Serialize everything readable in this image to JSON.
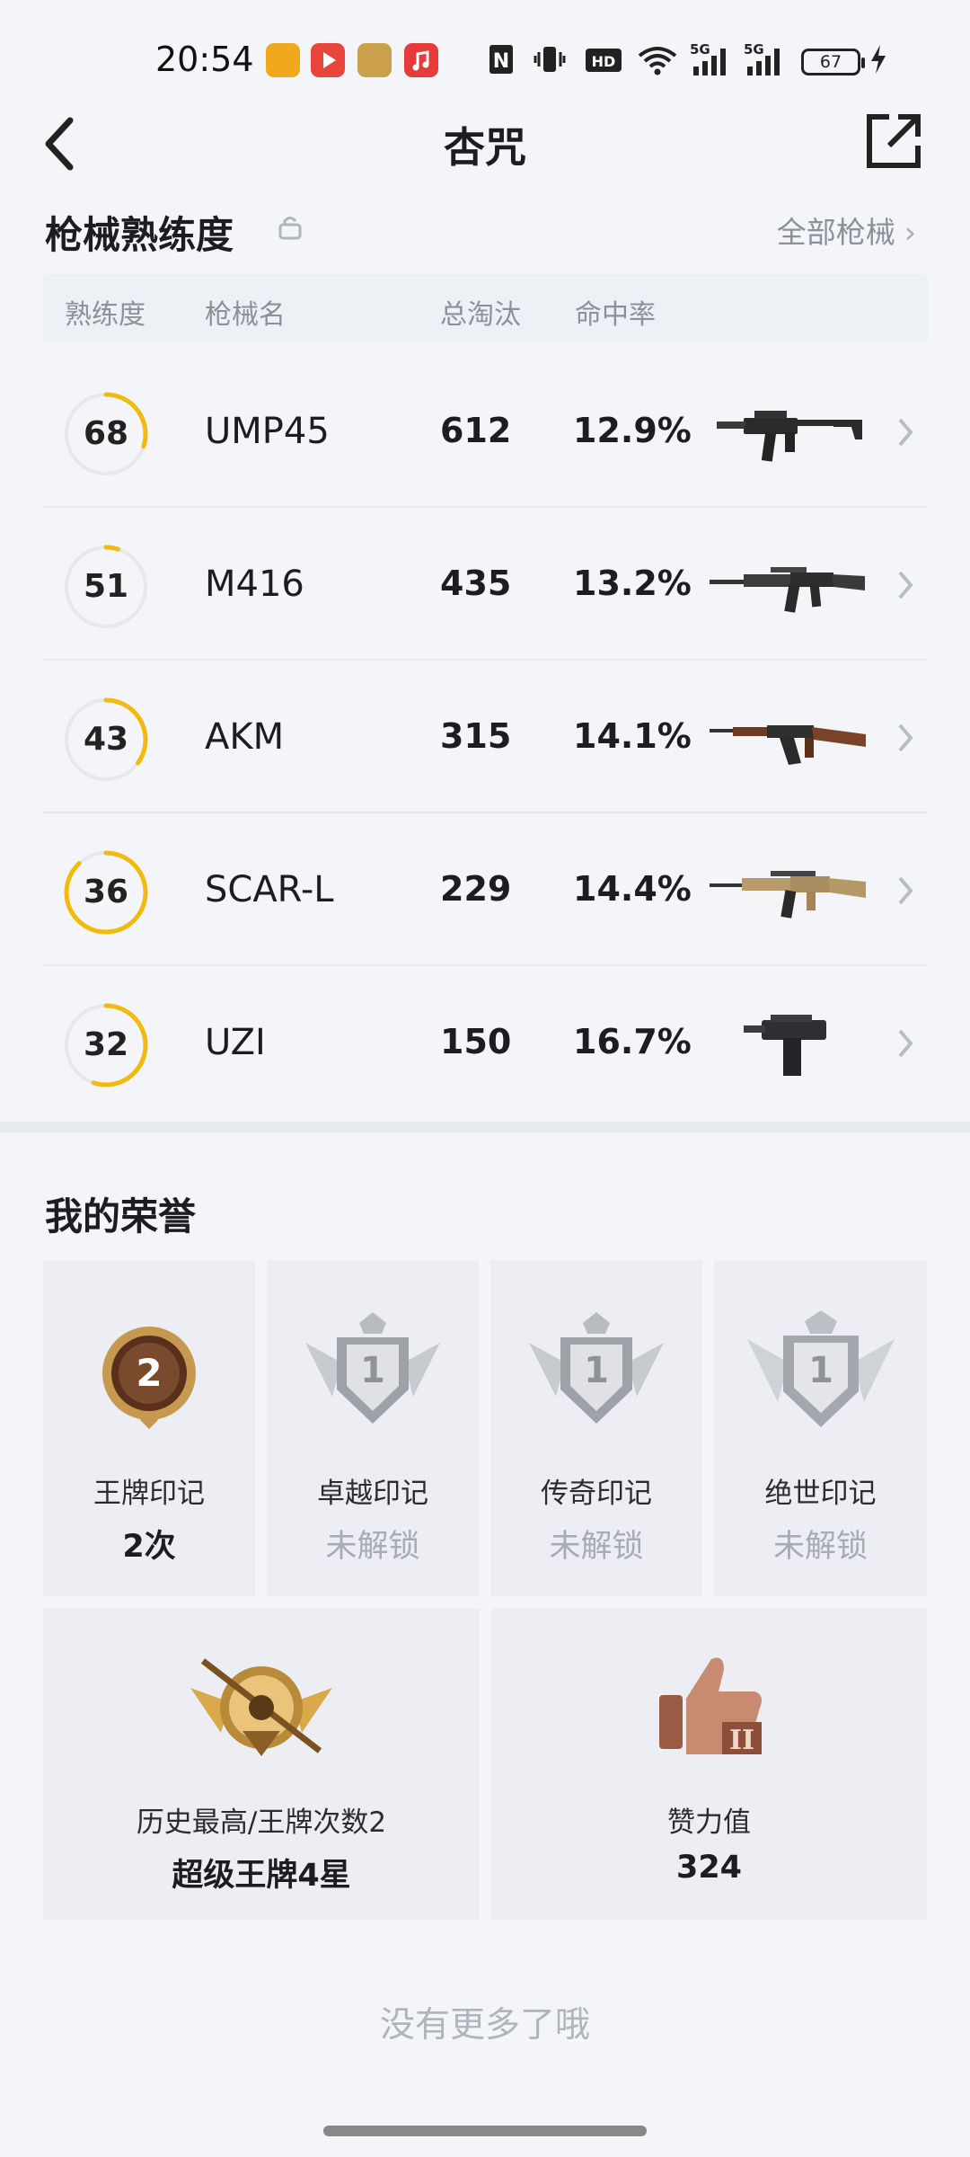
{
  "status_bar": {
    "time": "20:54",
    "battery": "67",
    "icons": [
      "nfc-icon",
      "vibrate-icon",
      "hd-icon",
      "wifi-icon",
      "signal-5g-icon",
      "signal-5g-icon",
      "battery-icon",
      "charging-icon"
    ],
    "notification_apps": [
      "app-icon-yellow",
      "app-icon-play",
      "app-icon-game",
      "app-icon-music"
    ]
  },
  "header": {
    "title": "杏咒",
    "back_icon": "back-chevron-icon",
    "share_icon": "share-icon"
  },
  "weapons": {
    "section_title": "枪械熟练度",
    "all_link": "全部枪械",
    "headers": {
      "proficiency": "熟练度",
      "name": "枪械名",
      "kills": "总淘汰",
      "hit_rate": "命中率"
    },
    "rows": [
      {
        "proficiency": "68",
        "progress": 0.3,
        "name": "UMP45",
        "kills": "612",
        "hit_rate": "12.9%",
        "weapon": "smg"
      },
      {
        "proficiency": "51",
        "progress": 0.05,
        "name": "M416",
        "kills": "435",
        "hit_rate": "13.2%",
        "weapon": "rifle"
      },
      {
        "proficiency": "43",
        "progress": 0.35,
        "name": "AKM",
        "kills": "315",
        "hit_rate": "14.1%",
        "weapon": "ak"
      },
      {
        "proficiency": "36",
        "progress": 0.88,
        "name": "SCAR-L",
        "kills": "229",
        "hit_rate": "14.4%",
        "weapon": "scar"
      },
      {
        "proficiency": "32",
        "progress": 0.55,
        "name": "UZI",
        "kills": "150",
        "hit_rate": "16.7%",
        "weapon": "uzi"
      }
    ],
    "progress_color": "#f2b90f"
  },
  "honors": {
    "section_title": "我的荣誉",
    "badges": [
      {
        "label": "王牌印记",
        "value": "2次",
        "locked": false,
        "badge_num": "2",
        "badge_icon": "ace-badge-icon"
      },
      {
        "label": "卓越印记",
        "value": "未解锁",
        "locked": true,
        "badge_num": "1",
        "badge_icon": "excellence-badge-icon"
      },
      {
        "label": "传奇印记",
        "value": "未解锁",
        "locked": true,
        "badge_num": "1",
        "badge_icon": "legend-badge-icon"
      },
      {
        "label": "绝世印记",
        "value": "未解锁",
        "locked": true,
        "badge_num": "1",
        "badge_icon": "peerless-badge-icon"
      }
    ],
    "history": {
      "label": "历史最高/王牌次数2",
      "value": "超级王牌4星",
      "icon": "tier-emblem-icon"
    },
    "likes": {
      "label": "赞力值",
      "value": "324",
      "icon": "thumbs-up-icon",
      "badge_num": "II"
    }
  },
  "footer": {
    "no_more": "没有更多了哦"
  }
}
